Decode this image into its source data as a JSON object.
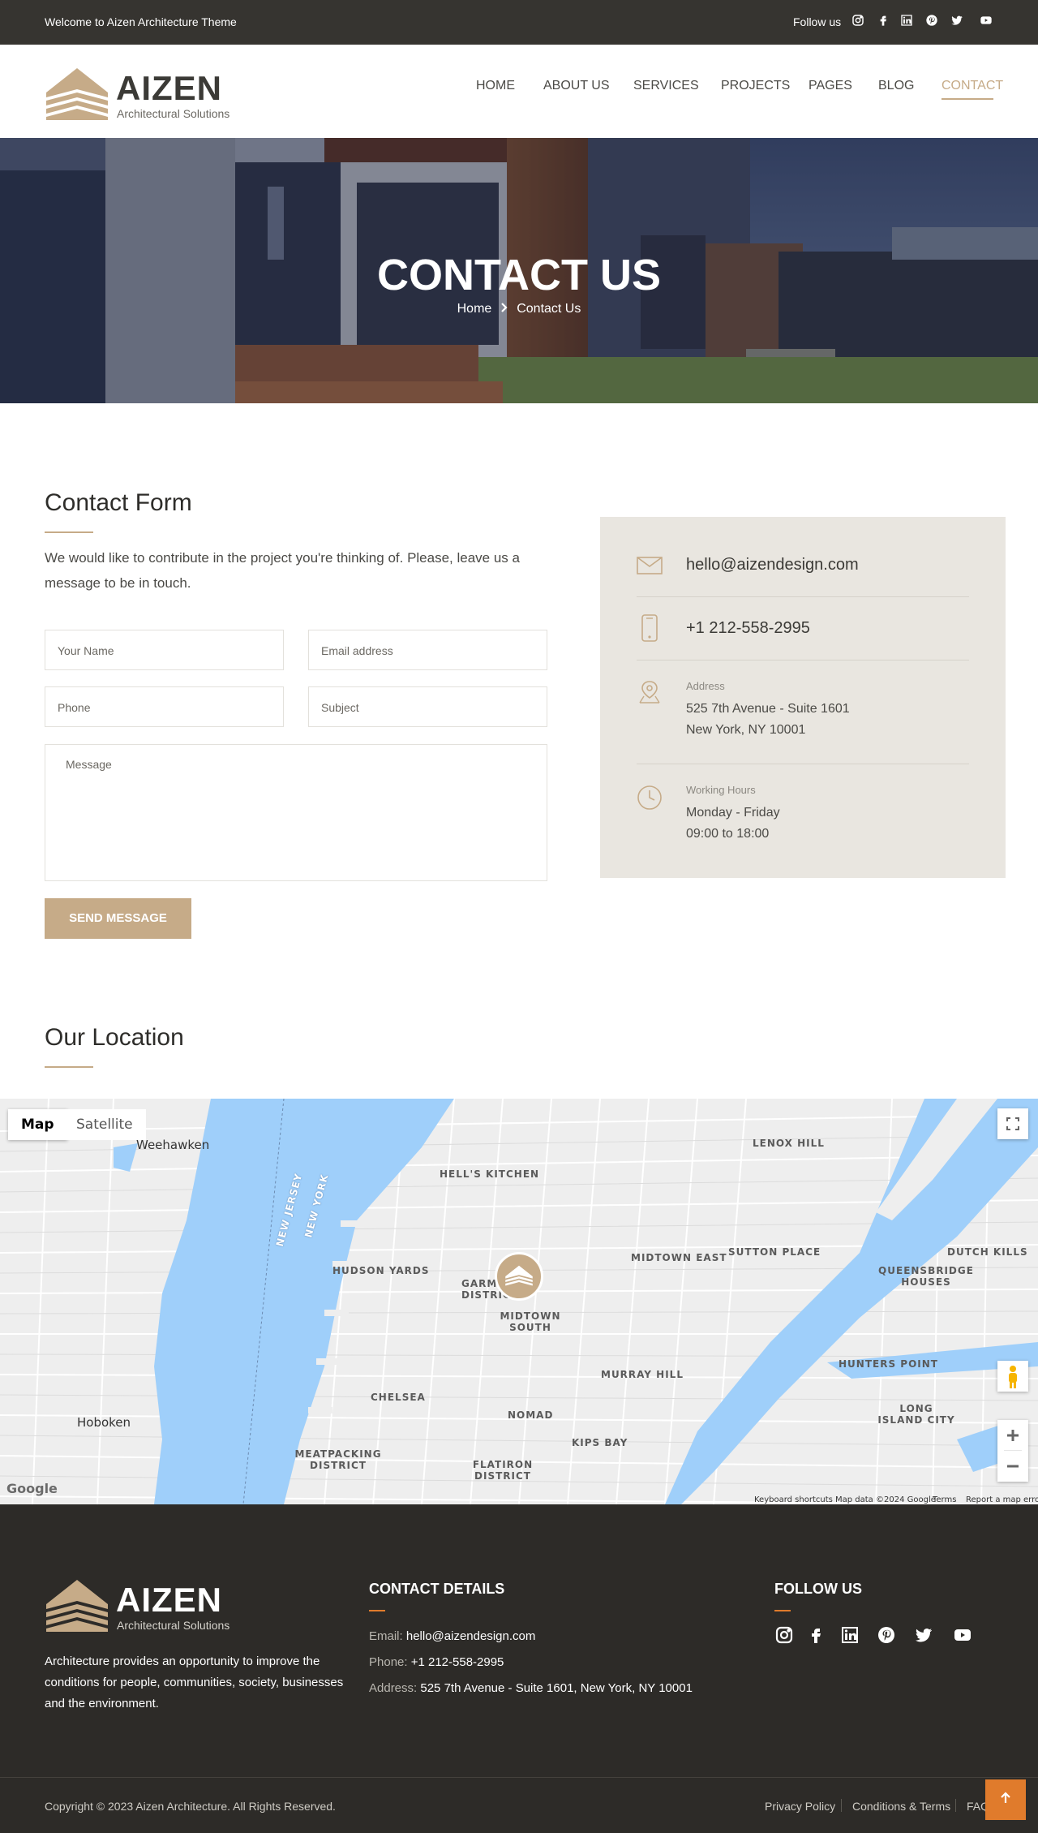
{
  "topbar": {
    "welcome": "Welcome to Aizen Architecture Theme",
    "follow_label": "Follow us",
    "social_icons": [
      "instagram-icon",
      "facebook-icon",
      "linkedin-icon",
      "pinterest-icon",
      "twitter-icon",
      "youtube-icon"
    ]
  },
  "header": {
    "logo_name": "AIZEN",
    "logo_sub": "Architectural Solutions",
    "nav": [
      "HOME",
      "ABOUT US",
      "SERVICES",
      "PROJECTS",
      "PAGES",
      "BLOG",
      "CONTACT"
    ],
    "active_nav": "CONTACT"
  },
  "hero": {
    "title": "CONTACT US",
    "breadcrumb": [
      "Home",
      "Contact Us"
    ]
  },
  "contact_form": {
    "title": "Contact Form",
    "intro": "We would like to contribute in the project you're thinking of. Please, leave us a message to be in touch.",
    "placeholders": {
      "name": "Your Name",
      "email": "Email address",
      "phone": "Phone",
      "subject": "Subject",
      "message": "Message"
    },
    "submit_label": "SEND MESSAGE"
  },
  "contact_info": {
    "email": "hello@aizendesign.com",
    "phone": "+1 212-558-2995",
    "address_label": "Address",
    "address_line1": "525 7th Avenue - Suite 1601",
    "address_line2": "New York, NY 10001",
    "hours_label": "Working Hours",
    "hours_line1": "Monday - Friday",
    "hours_line2": "09:00 to 18:00"
  },
  "location": {
    "title": "Our Location",
    "map_tabs": [
      "Map",
      "Satellite"
    ],
    "active_tab": "Map",
    "map_labels": [
      "Weehawken",
      "HELL'S KITCHEN",
      "LENOX HILL",
      "HUDSON YARDS",
      "GARMENT DISTRICT",
      "MIDTOWN SOUTH",
      "MIDTOWN EAST",
      "SUTTON PLACE",
      "DUTCH KILLS",
      "QUEENSBRIDGE HOUSES",
      "HUNTERS POINT",
      "MURRAY HILL",
      "CHELSEA",
      "NOMAD",
      "KIPS BAY",
      "LONG ISLAND CITY",
      "Hoboken",
      "MEATPACKING DISTRICT",
      "FLATIRON DISTRICT",
      "NEW JERSEY",
      "NEW YORK"
    ],
    "map_footer": [
      "Keyboard shortcuts",
      "Map data ©2024 Google",
      "Terms",
      "Report a map error"
    ],
    "google_logo": "Google"
  },
  "footer": {
    "logo_name": "AIZEN",
    "logo_sub": "Architectural Solutions",
    "about": "Architecture provides an opportunity to improve the conditions for people, communities, society, businesses and the environment.",
    "contact_title": "CONTACT DETAILS",
    "email_label": "Email:",
    "email": "hello@aizendesign.com",
    "phone_label": "Phone:",
    "phone": "+1 212-558-2995",
    "address_label": "Address:",
    "address": "525 7th Avenue - Suite 1601, New York, NY 10001",
    "follow_title": "FOLLOW US",
    "copyright": "Copyright © 2023 Aizen Architecture. All Rights Reserved.",
    "legal_links": [
      "Privacy Policy",
      "Conditions & Terms",
      "FAQ"
    ]
  },
  "colors": {
    "accent": "#c6ab88",
    "dark": "#363430",
    "footer_bg": "#2d2b28",
    "orange": "#e07b2c",
    "info_bg": "#e9e6e0",
    "water": "#9fcffa"
  }
}
